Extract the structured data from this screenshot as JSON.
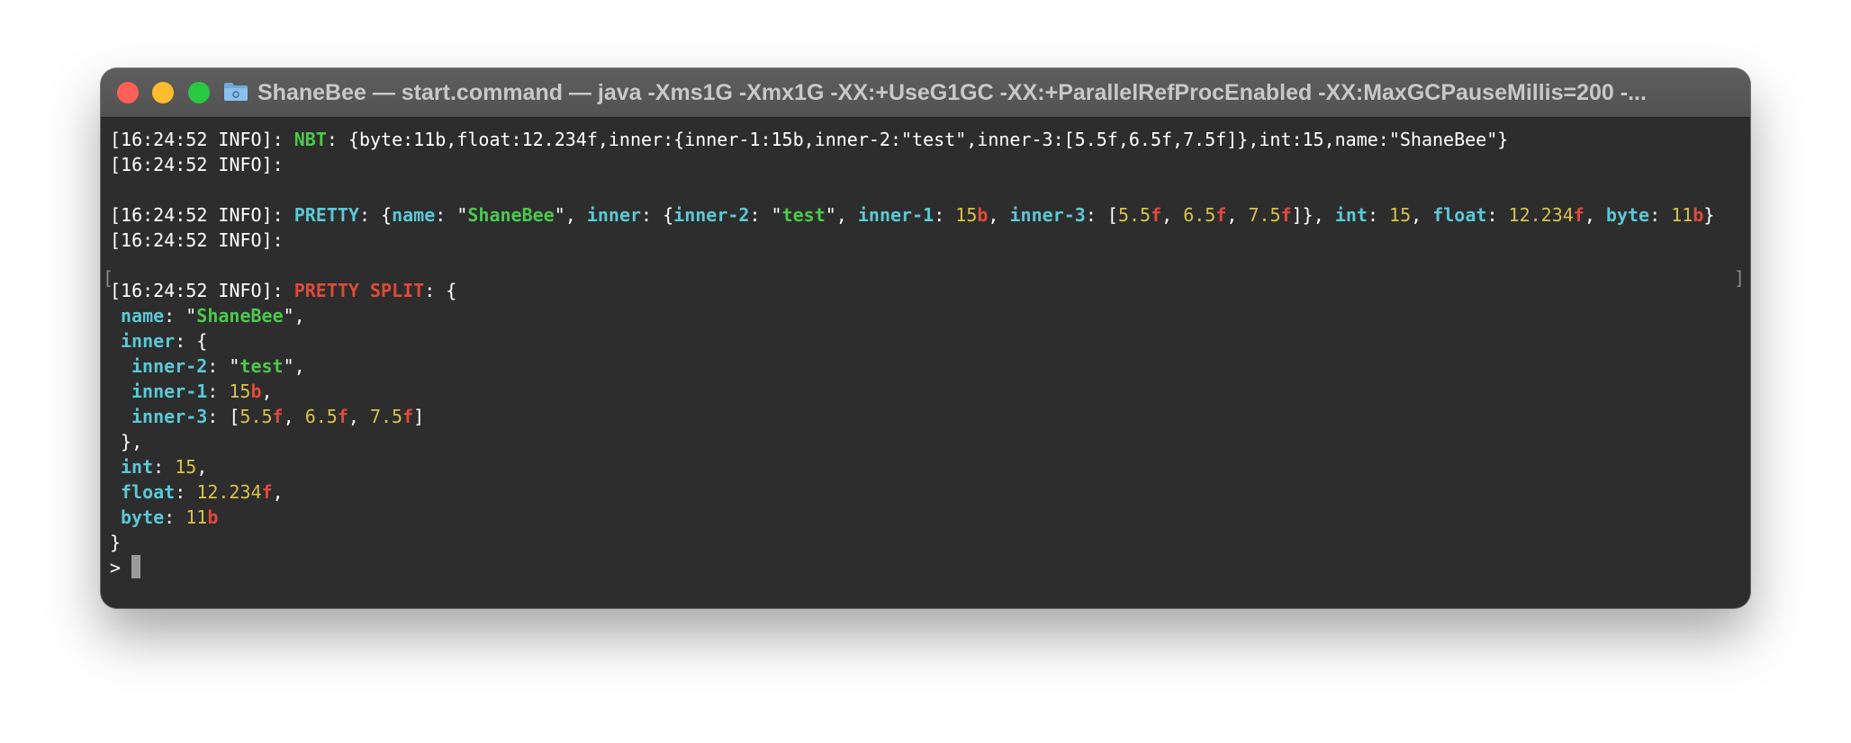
{
  "window": {
    "title": "ShaneBee — start.command — java -Xms1G -Xmx1G -XX:+UseG1GC -XX:+ParallelRefProcEnabled -XX:MaxGCPauseMillis=200 -...",
    "close_glyph": "×"
  },
  "terminal": {
    "prefix": "[16:24:52 INFO]: ",
    "nbt": {
      "label": "NBT",
      "value": ": {byte:11b,float:12.234f,inner:{inner-1:15b,inner-2:\"test\",inner-3:[5.5f,6.5f,7.5f]},int:15,name:\"ShaneBee\"}"
    },
    "empty_info": "[16:24:52 INFO]:",
    "pretty": {
      "label": "PRETTY"
    },
    "pretty_split": {
      "label": "PRETTY SPLIT",
      "open": ": {"
    },
    "keys": {
      "name": "name",
      "inner": "inner",
      "inner1": "inner-1",
      "inner2": "inner-2",
      "inner3": "inner-3",
      "int": "int",
      "float": "float",
      "byte": "byte"
    },
    "values": {
      "name": "ShaneBee",
      "inner2": "test",
      "inner1": "15",
      "inner3": [
        "5.5",
        "6.5",
        "7.5"
      ],
      "int": "15",
      "float": "12.234",
      "byte": "11"
    },
    "suffix": {
      "byte": "b",
      "float": "f"
    },
    "bracket_left": "[",
    "bracket_right": "]",
    "closing_inner": " },",
    "closing": "}",
    "prompt": ">"
  }
}
